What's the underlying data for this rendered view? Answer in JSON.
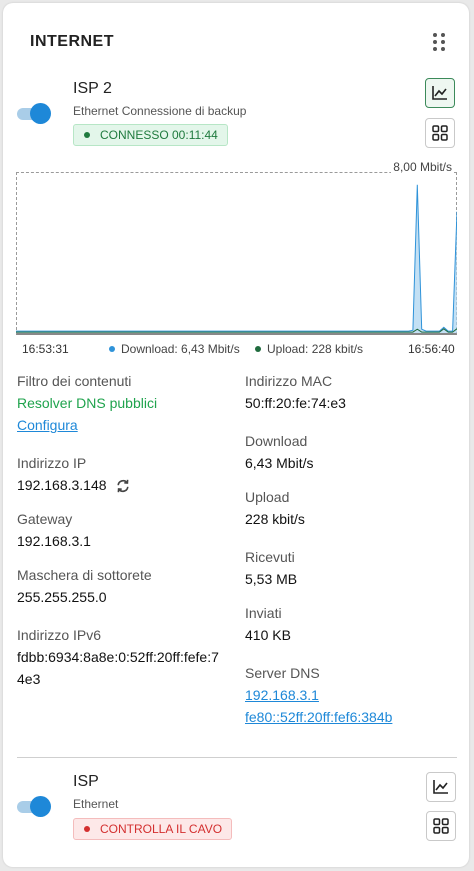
{
  "header": {
    "title": "INTERNET",
    "menu_icon": "drag-dots-icon"
  },
  "isp2": {
    "name": "ISP 2",
    "subtitle": "Ethernet Connessione di backup",
    "status": "CONNESSO 00:11:44",
    "enabled": true,
    "chart_button_icon": "line-chart-icon",
    "grid_button_icon": "grid-icon"
  },
  "chart_data": {
    "type": "area",
    "ymax_label": "8,00 Mbit/s",
    "ylim": [
      0,
      8
    ],
    "xlabel_start": "16:53:31",
    "xlabel_end": "16:56:40",
    "legend": {
      "download": "Download: 6,43 Mbit/s",
      "upload": "Upload: 228 kbit/s"
    },
    "colors": {
      "download": "#2f93d9",
      "upload": "#1f6b3d"
    },
    "series": [
      {
        "name": "Download",
        "values": [
          0.1,
          0.1,
          0.1,
          0.1,
          0.1,
          0.1,
          0.1,
          0.1,
          0.1,
          0.1,
          0.1,
          0.1,
          0.1,
          0.1,
          0.1,
          0.1,
          0.1,
          0.1,
          0.1,
          0.1,
          0.1,
          0.1,
          0.1,
          0.1,
          0.1,
          0.1,
          0.1,
          0.1,
          0.1,
          0.1,
          0.1,
          0.1,
          0.1,
          0.1,
          0.1,
          0.1,
          0.1,
          0.1,
          0.1,
          0.1,
          0.1,
          0.1,
          0.1,
          0.1,
          0.1,
          0.1,
          0.1,
          0.1,
          0.1,
          0.1,
          0.1,
          0.1,
          0.1,
          0.1,
          0.1,
          0.1,
          0.1,
          0.1,
          0.1,
          0.1,
          0.1,
          0.1,
          0.1,
          0.1,
          0.1,
          0.1,
          0.1,
          0.1,
          0.1,
          0.1,
          0.1,
          0.1,
          0.1,
          0.1,
          0.1,
          0.1,
          0.1,
          0.1,
          0.1,
          0.1,
          0.1,
          0.1,
          0.1,
          0.1,
          0.1,
          0.1,
          0.1,
          0.1,
          0.1,
          0.1,
          0.15,
          7.85,
          0.2,
          0.1,
          0.1,
          0.1,
          0.1,
          0.3,
          0.1,
          0.1,
          6.43
        ]
      },
      {
        "name": "Upload",
        "values": [
          0.05,
          0.05,
          0.05,
          0.05,
          0.05,
          0.05,
          0.05,
          0.05,
          0.05,
          0.05,
          0.05,
          0.05,
          0.05,
          0.05,
          0.05,
          0.05,
          0.05,
          0.05,
          0.05,
          0.05,
          0.05,
          0.05,
          0.05,
          0.05,
          0.05,
          0.05,
          0.05,
          0.05,
          0.05,
          0.05,
          0.05,
          0.05,
          0.05,
          0.05,
          0.05,
          0.05,
          0.05,
          0.05,
          0.05,
          0.05,
          0.05,
          0.05,
          0.05,
          0.05,
          0.05,
          0.05,
          0.05,
          0.05,
          0.05,
          0.05,
          0.05,
          0.05,
          0.05,
          0.05,
          0.05,
          0.05,
          0.05,
          0.05,
          0.05,
          0.05,
          0.05,
          0.05,
          0.05,
          0.05,
          0.05,
          0.05,
          0.05,
          0.05,
          0.05,
          0.05,
          0.05,
          0.05,
          0.05,
          0.05,
          0.05,
          0.05,
          0.05,
          0.05,
          0.05,
          0.05,
          0.05,
          0.05,
          0.05,
          0.05,
          0.05,
          0.05,
          0.05,
          0.05,
          0.05,
          0.05,
          0.05,
          0.2,
          0.05,
          0.05,
          0.05,
          0.05,
          0.05,
          0.22,
          0.05,
          0.05,
          0.228
        ]
      }
    ]
  },
  "details_left": [
    {
      "label": "Filtro dei contenuti",
      "value": "Resolver DNS pubblici",
      "link": "Configura"
    },
    {
      "label": "Indirizzo IP",
      "value": "192.168.3.148",
      "icon": "refresh-icon"
    },
    {
      "label": "Gateway",
      "value": "192.168.3.1"
    },
    {
      "label": "Maschera di sottorete",
      "value": "255.255.255.0"
    },
    {
      "label": "Indirizzo IPv6",
      "value_line1": "fdbb:6934:8a8e:0:52ff:20ff:fefe:7",
      "value_line2": "4e3"
    }
  ],
  "details_right": [
    {
      "label": "Indirizzo MAC",
      "value": "50:ff:20:fe:74:e3"
    },
    {
      "label": "Download",
      "value": "6,43 Mbit/s"
    },
    {
      "label": "Upload",
      "value": "228 kbit/s"
    },
    {
      "label": "Ricevuti",
      "value": "5,53 MB"
    },
    {
      "label": "Inviati",
      "value": "410 KB"
    },
    {
      "label": "Server DNS",
      "links": [
        "192.168.3.1",
        "fe80::52ff:20ff:fef6:384b"
      ]
    }
  ],
  "isp1": {
    "name": "ISP",
    "subtitle": "Ethernet",
    "status": "CONTROLLA IL CAVO",
    "enabled": true,
    "chart_button_icon": "line-chart-icon",
    "grid_button_icon": "grid-icon"
  }
}
